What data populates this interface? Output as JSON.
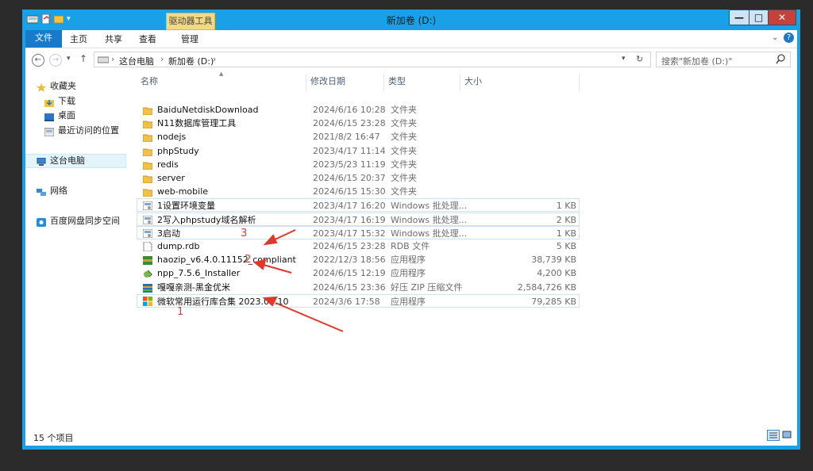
{
  "window": {
    "title": "新加卷 (D:)",
    "contextual_tab": "驱动器工具",
    "buttons": {
      "minimize": "—",
      "maximize": "□",
      "close": "✕"
    }
  },
  "ribbon": {
    "tabs": [
      "文件",
      "主页",
      "共享",
      "查看",
      "管理"
    ]
  },
  "address": {
    "path": [
      "这台电脑",
      "新加卷 (D:)"
    ],
    "search_placeholder": "搜索\"新加卷 (D:)\""
  },
  "nav": {
    "favorites": "收藏夹",
    "favorites_items": [
      "下载",
      "桌面",
      "最近访问的位置"
    ],
    "this_pc": "这台电脑",
    "network": "网络",
    "baidu": "百度网盘同步空间"
  },
  "columns": [
    "名称",
    "修改日期",
    "类型",
    "大小"
  ],
  "files": [
    {
      "name": "BaiduNetdiskDownload",
      "date": "2024/6/16 10:28",
      "type": "文件夹",
      "size": "",
      "icon": "folder-icon"
    },
    {
      "name": "N11数据库管理工具",
      "date": "2024/6/15 23:28",
      "type": "文件夹",
      "size": "",
      "icon": "folder-icon"
    },
    {
      "name": "nodejs",
      "date": "2021/8/2 16:47",
      "type": "文件夹",
      "size": "",
      "icon": "folder-icon"
    },
    {
      "name": "phpStudy",
      "date": "2023/4/17 11:14",
      "type": "文件夹",
      "size": "",
      "icon": "folder-icon"
    },
    {
      "name": "redis",
      "date": "2023/5/23 11:19",
      "type": "文件夹",
      "size": "",
      "icon": "folder-icon"
    },
    {
      "name": "server",
      "date": "2024/6/15 20:37",
      "type": "文件夹",
      "size": "",
      "icon": "folder-icon"
    },
    {
      "name": "web-mobile",
      "date": "2024/6/15 15:30",
      "type": "文件夹",
      "size": "",
      "icon": "folder-icon"
    },
    {
      "name": "1设置环境变量",
      "date": "2023/4/17 16:20",
      "type": "Windows 批处理...",
      "size": "1 KB",
      "icon": "batch-icon"
    },
    {
      "name": "2写入phpstudy域名解析",
      "date": "2023/4/17 16:19",
      "type": "Windows 批处理...",
      "size": "2 KB",
      "icon": "batch-icon"
    },
    {
      "name": "3启动",
      "date": "2023/4/17 15:32",
      "type": "Windows 批处理...",
      "size": "1 KB",
      "icon": "batch-icon"
    },
    {
      "name": "dump.rdb",
      "date": "2024/6/15 23:28",
      "type": "RDB 文件",
      "size": "5 KB",
      "icon": "file-icon"
    },
    {
      "name": "haozip_v6.4.0.11152_compliant",
      "date": "2022/12/3 18:56",
      "type": "应用程序",
      "size": "38,739 KB",
      "icon": "haozip-icon"
    },
    {
      "name": "npp_7.5.6_Installer",
      "date": "2024/6/15 12:19",
      "type": "应用程序",
      "size": "4,200 KB",
      "icon": "npp-icon"
    },
    {
      "name": "嘎嘎亲测-黑金优米",
      "date": "2024/6/15 23:36",
      "type": "好压 ZIP 压缩文件",
      "size": "2,584,726 KB",
      "icon": "zip-icon"
    },
    {
      "name": "微软常用运行库合集 2023.08.10",
      "date": "2024/3/6 17:58",
      "type": "应用程序",
      "size": "79,285 KB",
      "icon": "windows-logo-icon"
    }
  ],
  "status": {
    "count": "15 个项目"
  },
  "annotations": {
    "a1": "1",
    "a2": "2",
    "a3": "3"
  },
  "colors": {
    "title_bar": "#19a0e6",
    "file_tab": "#1979ca",
    "arrow": "#e3372a"
  }
}
